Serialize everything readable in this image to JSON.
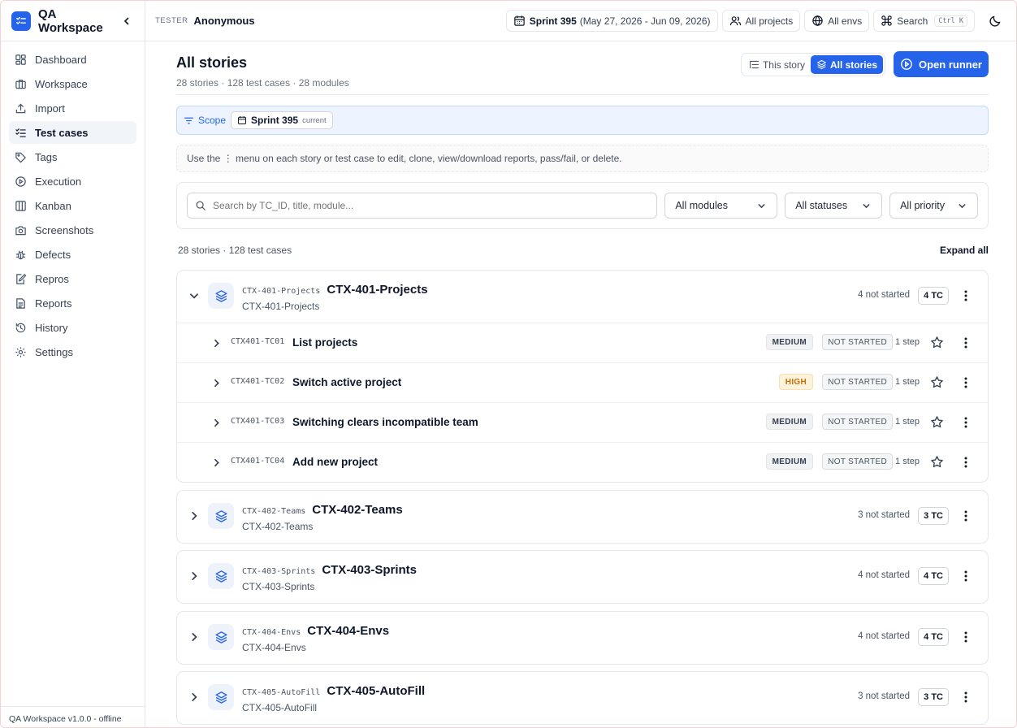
{
  "app": {
    "name": "QA Workspace",
    "footer": "QA Workspace v1.0.0 - offline"
  },
  "sidebar": {
    "items": [
      {
        "label": "Dashboard",
        "icon": "dashboard-icon"
      },
      {
        "label": "Workspace",
        "icon": "briefcase-icon"
      },
      {
        "label": "Import",
        "icon": "upload-icon"
      },
      {
        "label": "Test cases",
        "icon": "checklist-icon",
        "active": true
      },
      {
        "label": "Tags",
        "icon": "tag-icon"
      },
      {
        "label": "Execution",
        "icon": "play-circle-icon"
      },
      {
        "label": "Kanban",
        "icon": "kanban-icon"
      },
      {
        "label": "Screenshots",
        "icon": "camera-icon"
      },
      {
        "label": "Defects",
        "icon": "bug-icon"
      },
      {
        "label": "Repros",
        "icon": "file-edit-icon"
      },
      {
        "label": "Reports",
        "icon": "report-icon"
      },
      {
        "label": "History",
        "icon": "history-icon"
      },
      {
        "label": "Settings",
        "icon": "gear-icon"
      }
    ]
  },
  "topbar": {
    "tester_label": "TESTER",
    "tester_name": "Anonymous",
    "sprint_name": "Sprint 395",
    "sprint_range": "(May 27, 2026 - Jun 09, 2026)",
    "projects": "All projects",
    "envs": "All envs",
    "search": "Search",
    "search_shortcut": "Ctrl K"
  },
  "page": {
    "title": "All stories",
    "subtitle": "28 stories · 128 test cases · 28 modules",
    "view_this_story": "This story",
    "view_all_stories": "All stories",
    "open_runner": "Open runner"
  },
  "scope": {
    "label": "Scope",
    "sprint": "Sprint 395",
    "badge": "current"
  },
  "hint": {
    "before": "Use the ",
    "glyph": "⋮",
    "after": " menu on each story or test case to edit, clone, view/download reports, pass/fail, or delete."
  },
  "filters": {
    "search_placeholder": "Search by TC_ID, title, module...",
    "modules": "All modules",
    "statuses": "All statuses",
    "priority": "All priority"
  },
  "list": {
    "meta": "28 stories · 128 test cases",
    "expand_all": "Expand all"
  },
  "stories": [
    {
      "code": "CTX-401-Projects",
      "title": "CTX-401-Projects",
      "module": "CTX-401-Projects",
      "status": "4 not started",
      "tc_count": "4 TC",
      "expanded": true,
      "cases": [
        {
          "id": "CTX401-TC01",
          "title": "List projects",
          "priority": "MEDIUM",
          "state": "NOT STARTED",
          "steps": "1 step"
        },
        {
          "id": "CTX401-TC02",
          "title": "Switch active project",
          "priority": "HIGH",
          "state": "NOT STARTED",
          "steps": "1 step"
        },
        {
          "id": "CTX401-TC03",
          "title": "Switching clears incompatible team",
          "priority": "MEDIUM",
          "state": "NOT STARTED",
          "steps": "1 step"
        },
        {
          "id": "CTX401-TC04",
          "title": "Add new project",
          "priority": "MEDIUM",
          "state": "NOT STARTED",
          "steps": "1 step"
        }
      ]
    },
    {
      "code": "CTX-402-Teams",
      "title": "CTX-402-Teams",
      "module": "CTX-402-Teams",
      "status": "3 not started",
      "tc_count": "3 TC"
    },
    {
      "code": "CTX-403-Sprints",
      "title": "CTX-403-Sprints",
      "module": "CTX-403-Sprints",
      "status": "4 not started",
      "tc_count": "4 TC"
    },
    {
      "code": "CTX-404-Envs",
      "title": "CTX-404-Envs",
      "module": "CTX-404-Envs",
      "status": "4 not started",
      "tc_count": "4 TC"
    },
    {
      "code": "CTX-405-AutoFill",
      "title": "CTX-405-AutoFill",
      "module": "CTX-405-AutoFill",
      "status": "3 not started",
      "tc_count": "3 TC"
    }
  ],
  "colors": {
    "accent": "#2563eb",
    "high_priority_bg": "#fdf3dc",
    "high_priority_text": "#c2700a"
  }
}
